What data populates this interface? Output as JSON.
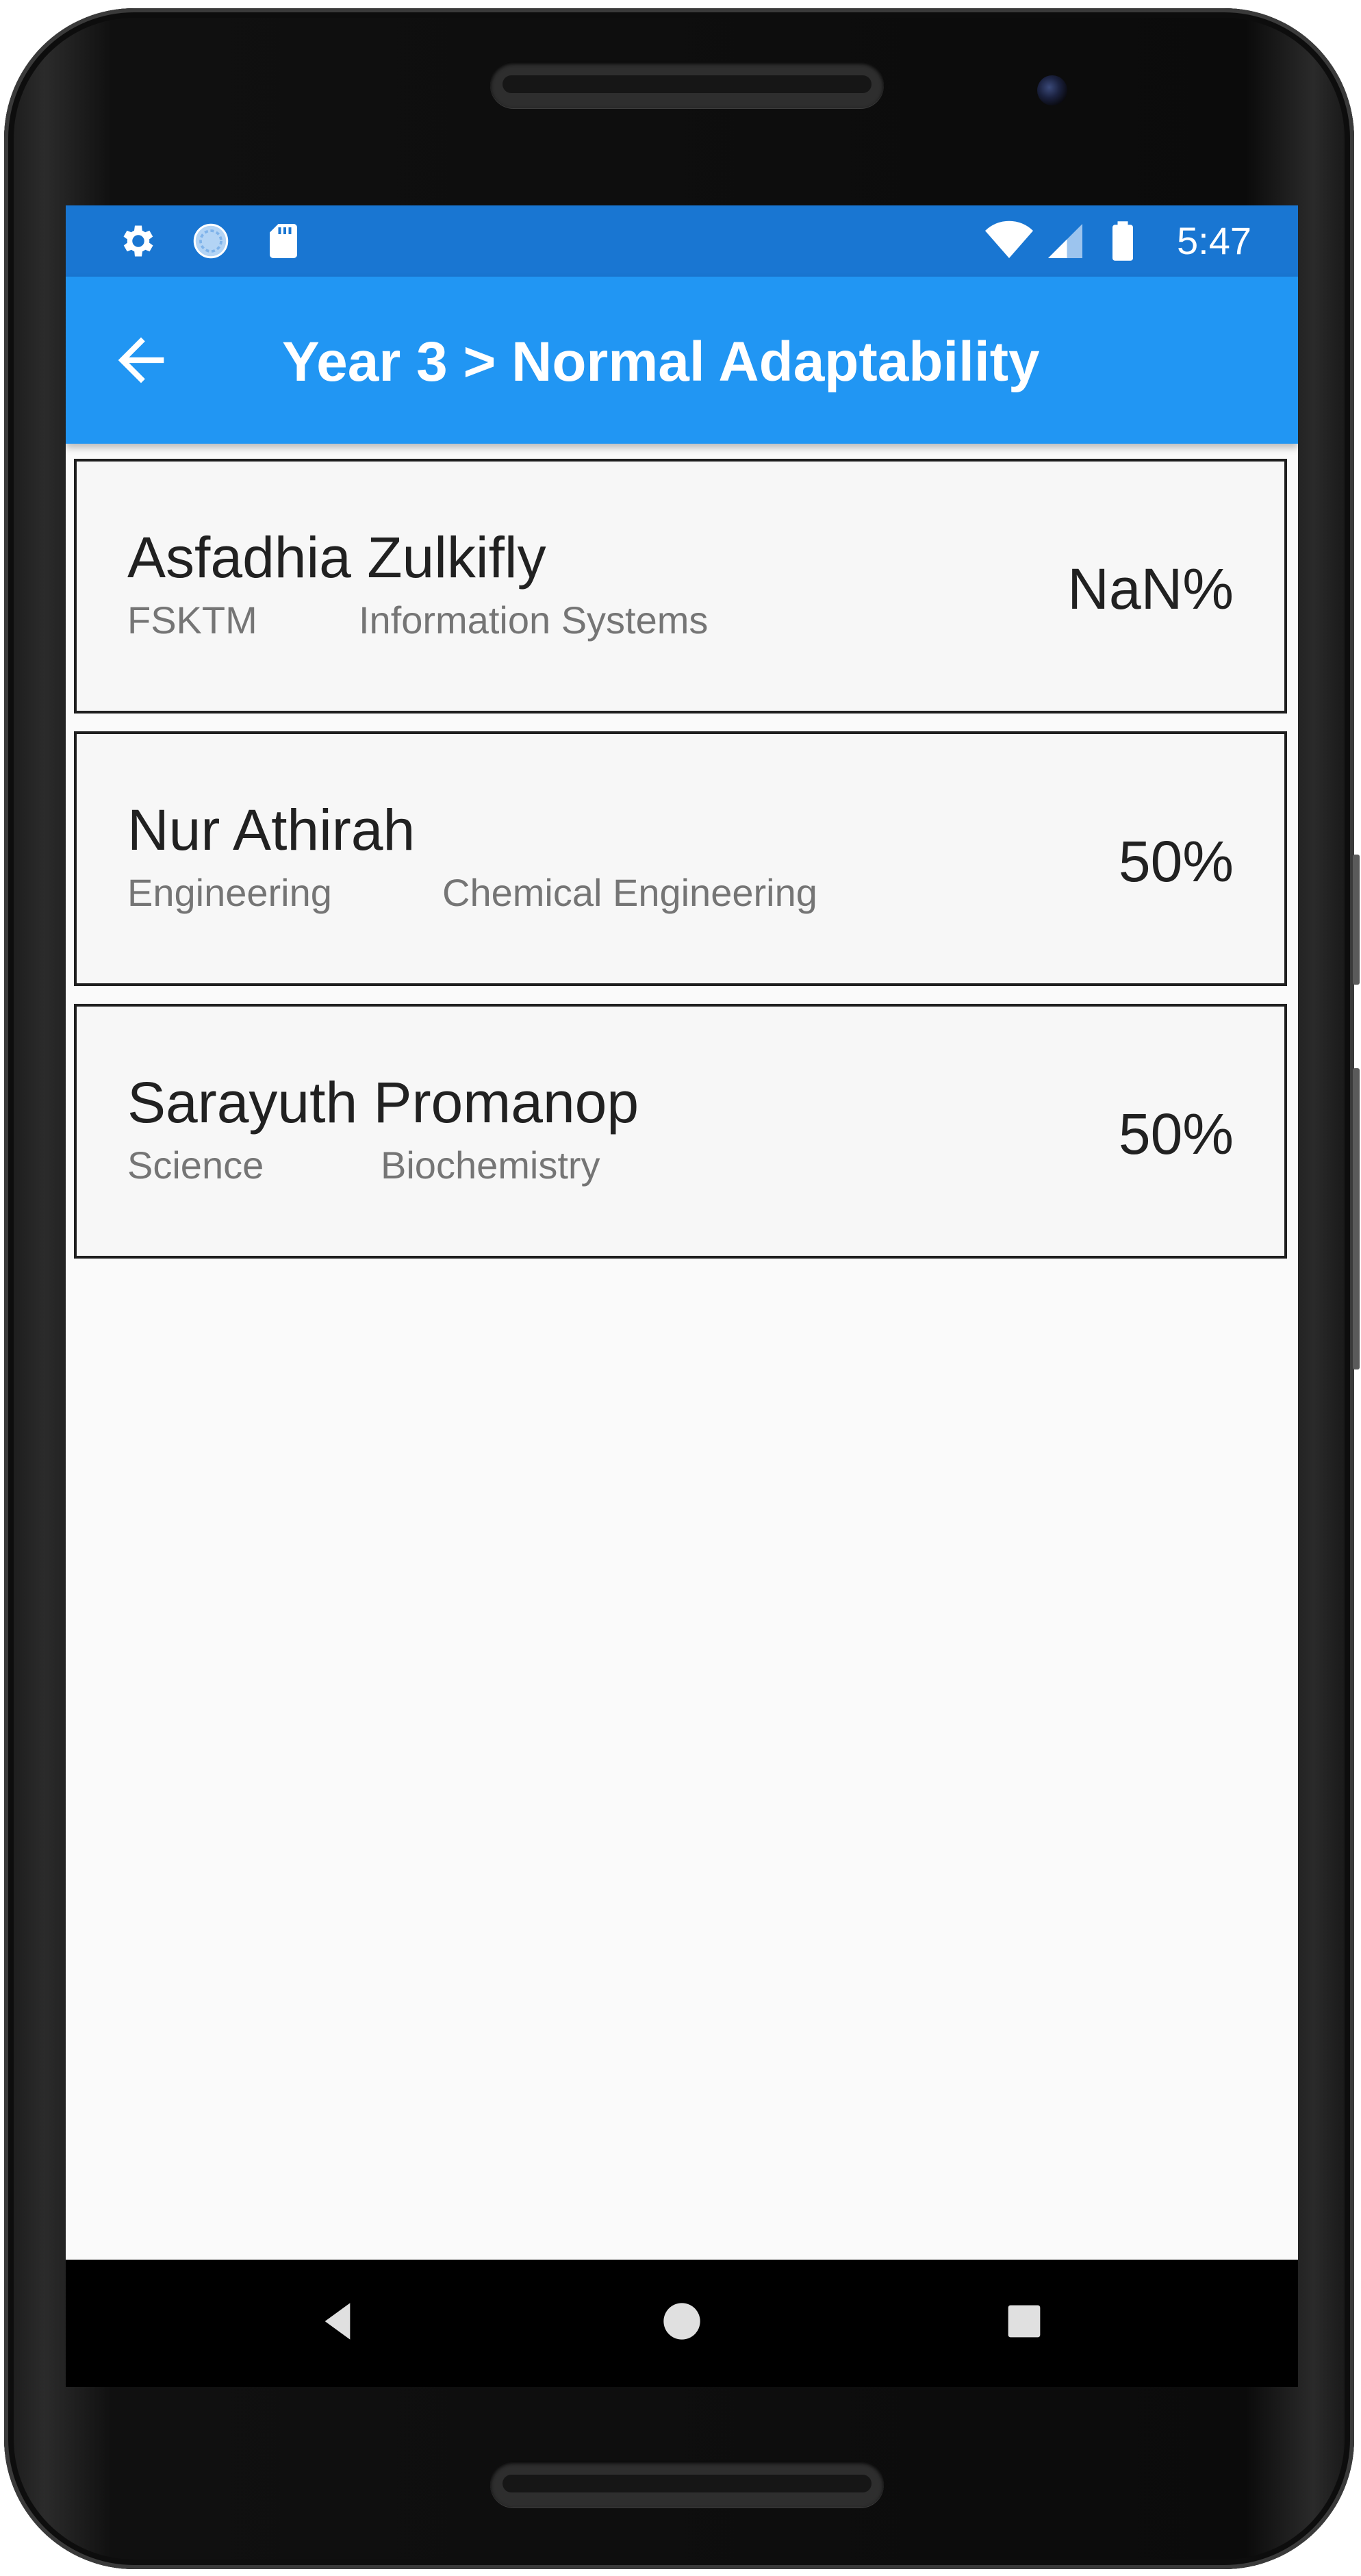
{
  "status_bar": {
    "time": "5:47",
    "left_icons": [
      "gear-icon",
      "sync-icon",
      "sd-card-icon"
    ],
    "right_icons": [
      "wifi-icon",
      "signal-icon",
      "battery-icon"
    ],
    "background_color": "#1976d2"
  },
  "app_bar": {
    "title": "Year 3 > Normal Adaptability",
    "back_icon": "arrow-back-icon",
    "background_color": "#2196f3"
  },
  "students": [
    {
      "name": "Asfadhia Zulkifly",
      "faculty": "FSKTM",
      "program": "Information Systems",
      "score": "NaN%"
    },
    {
      "name": "Nur Athirah",
      "faculty": "Engineering",
      "program": "Chemical Engineering",
      "score": "50%"
    },
    {
      "name": "Sarayuth Promanop",
      "faculty": "Science",
      "program": "Biochemistry",
      "score": "50%"
    }
  ],
  "nav_bar": {
    "buttons": [
      "back-triangle-icon",
      "home-circle-icon",
      "recents-square-icon"
    ]
  }
}
